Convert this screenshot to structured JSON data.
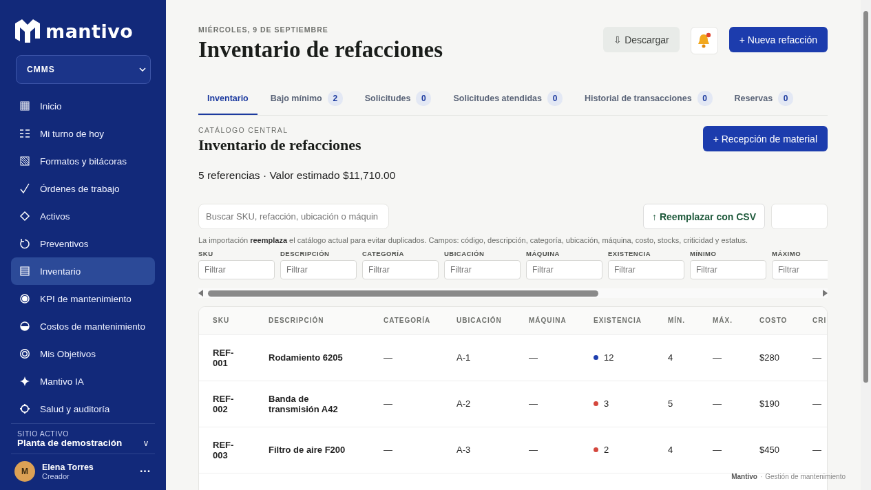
{
  "sidebar": {
    "logo": "mantivo",
    "module_select": {
      "value": "CMMS"
    },
    "items": [
      {
        "label": "Inicio",
        "selected": false
      },
      {
        "label": "Mi turno de hoy",
        "selected": false
      },
      {
        "label": "Formatos y bitácoras",
        "selected": false
      },
      {
        "label": "Órdenes de trabajo",
        "selected": false
      },
      {
        "label": "Activos",
        "selected": false
      },
      {
        "label": "Preventivos",
        "selected": false
      },
      {
        "label": "Inventario",
        "selected": true
      },
      {
        "label": "KPI de mantenimiento",
        "selected": false
      },
      {
        "label": "Costos de mantenimiento",
        "selected": false
      },
      {
        "label": "Mis Objetivos",
        "selected": false
      },
      {
        "label": "Mantivo IA",
        "selected": false
      },
      {
        "label": "Salud y auditoría",
        "selected": false
      }
    ],
    "site": {
      "label": "SITIO ACTIVO",
      "value": "Planta de demostración",
      "toggle": "v"
    },
    "user": {
      "initial": "M",
      "name": "Elena Torres",
      "role": "Creador",
      "menu": "···"
    }
  },
  "header": {
    "date": "MIÉRCOLES, 9 DE SEPTIEMBRE",
    "title": "Inventario de refacciones",
    "download_button": "⇩ Descargar",
    "notifications_unread": true,
    "new_button": "+ Nueva refacción"
  },
  "tabs": [
    {
      "label": "Inventario",
      "selected": true
    },
    {
      "label": "Bajo mínimo",
      "count": "2",
      "selected": false
    },
    {
      "label": "Solicitudes",
      "count": "0",
      "selected": false
    },
    {
      "label": "Solicitudes atendidas",
      "count": "0",
      "selected": false
    },
    {
      "label": "Historial de transacciones",
      "count": "0",
      "selected": false
    },
    {
      "label": "Reservas",
      "count": "0",
      "selected": false
    }
  ],
  "section": {
    "eyebrow": "CATÁLOGO CENTRAL",
    "title": "Inventario de refacciones",
    "summary": "5 referencias · Valor estimado $11,710.00",
    "reception_button": "+ Recepción de material"
  },
  "search": {
    "placeholder": "Buscar SKU, refacción, ubicación o máquin"
  },
  "csv_button": "↑ Reemplazar con CSV",
  "import_note": "La importación **reemplaza** el catálogo actual para evitar duplicados. Campos: código, descripción, categoría, ubicación, máquina, costo, stocks, criticidad y estatus.",
  "filters": [
    {
      "label": "SKU",
      "placeholder": "Filtrar"
    },
    {
      "label": "DESCRIPCIÓN",
      "placeholder": "Filtrar"
    },
    {
      "label": "CATEGORÍA",
      "placeholder": "Filtrar"
    },
    {
      "label": "UBICACIÓN",
      "placeholder": "Filtrar"
    },
    {
      "label": "MÁQUINA",
      "placeholder": "Filtrar"
    },
    {
      "label": "EXISTENCIA",
      "placeholder": "Filtrar"
    },
    {
      "label": "MÍNIMO",
      "placeholder": "Filtrar"
    },
    {
      "label": "MÁXIMO",
      "placeholder": "Filtrar"
    }
  ],
  "table": {
    "columns": [
      "SKU",
      "DESCRIPCIÓN",
      "CATEGORÍA",
      "UBICACIÓN",
      "MÁQUINA",
      "EXISTENCIA",
      "MÍN.",
      "MÁX.",
      "COSTO",
      "CRI"
    ],
    "rows": [
      {
        "sku": "REF-001",
        "description": "Rodamiento 6205",
        "category": "—",
        "location": "A-1",
        "machine": "—",
        "stock": "12",
        "color": "#1e3fae",
        "min": "4",
        "max": "—",
        "cost": "$280",
        "column_10": "—"
      },
      {
        "sku": "REF-002",
        "description": "Banda de transmisión A42",
        "category": "—",
        "location": "A-2",
        "machine": "—",
        "stock": "3",
        "color": "#d4473d",
        "min": "5",
        "max": "—",
        "cost": "$190",
        "column_10": "—"
      },
      {
        "sku": "REF-003",
        "description": "Filtro de aire F200",
        "category": "—",
        "location": "A-3",
        "machine": "—",
        "stock": "2",
        "color": "#d4473d",
        "min": "4",
        "max": "—",
        "cost": "$450",
        "column_10": "—"
      }
    ]
  },
  "footer": {
    "brand": "Mantivo",
    "separator": "·",
    "text": "Gestión de mantenimiento"
  }
}
